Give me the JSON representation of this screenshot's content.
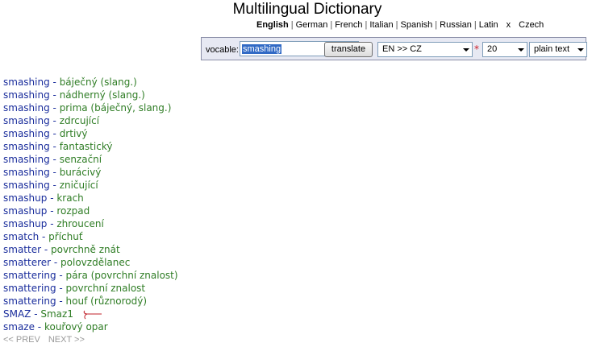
{
  "header": {
    "title": "Multilingual Dictionary",
    "languages": [
      "English",
      "German",
      "French",
      "Italian",
      "Spanish",
      "Russian",
      "Latin"
    ],
    "active_language": "English",
    "separator_x": "x",
    "target_language": "Czech"
  },
  "form": {
    "vocable_label": "vocable:",
    "vocable_value": "smashing",
    "translate_label": "translate",
    "direction_value": "EN >> CZ",
    "required_mark": "*",
    "count_value": "20",
    "format_value": "plain text"
  },
  "results": [
    {
      "en": "smashing",
      "cz": "báječný (slang.)"
    },
    {
      "en": "smashing",
      "cz": "nádherný (slang.)"
    },
    {
      "en": "smashing",
      "cz": "prima (báječný, slang.)"
    },
    {
      "en": "smashing",
      "cz": "zdrcující"
    },
    {
      "en": "smashing",
      "cz": "drtivý"
    },
    {
      "en": "smashing",
      "cz": "fantastický"
    },
    {
      "en": "smashing",
      "cz": "senzační"
    },
    {
      "en": "smashing",
      "cz": "burácivý"
    },
    {
      "en": "smashing",
      "cz": "zničující"
    },
    {
      "en": "smashup",
      "cz": "krach"
    },
    {
      "en": "smashup",
      "cz": "rozpad"
    },
    {
      "en": "smashup",
      "cz": "zhroucení"
    },
    {
      "en": "smatch",
      "cz": "příchuť"
    },
    {
      "en": "smatter",
      "cz": "povrchně znát"
    },
    {
      "en": "smatterer",
      "cz": "polovzdělanec"
    },
    {
      "en": "smattering",
      "cz": "pára (povrchní znalost)"
    },
    {
      "en": "smattering",
      "cz": "povrchní znalost"
    },
    {
      "en": "smattering",
      "cz": "houf (různorodý)"
    },
    {
      "en": "SMAZ",
      "cz": "Smaz1"
    },
    {
      "en": "smaze",
      "cz": "kouřový opar"
    }
  ],
  "pager": {
    "prev_label": "<< PREV",
    "next_label": "NEXT >>"
  },
  "colors": {
    "english_word": "#1a2d9c",
    "czech_word": "#2f7d25",
    "annotation_arrow": "#c0202a"
  },
  "icons": {
    "annotation": "left-arrow-icon"
  }
}
